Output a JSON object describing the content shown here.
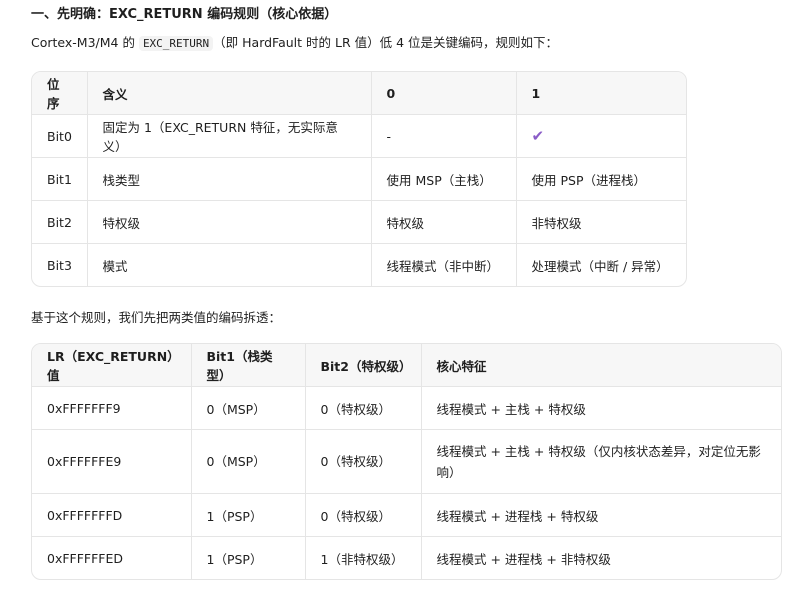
{
  "heading": "一、先明确：EXC_RETURN 编码规则（核心依据）",
  "intro": {
    "before": "Cortex-M3/M4 的 ",
    "code": "EXC_RETURN",
    "after": "（即 HardFault 时的 LR 值）低 4 位是关键编码，规则如下："
  },
  "table1": {
    "headers": [
      "位序",
      "含义",
      "0",
      "1"
    ],
    "rows": [
      [
        "Bit0",
        "固定为 1（EXC_RETURN 特征，无实际意义）",
        "-",
        "✔"
      ],
      [
        "Bit1",
        "栈类型",
        "使用 MSP（主栈）",
        "使用 PSP（进程栈）"
      ],
      [
        "Bit2",
        "特权级",
        "特权级",
        "非特权级"
      ],
      [
        "Bit3",
        "模式",
        "线程模式（非中断）",
        "处理模式（中断 / 异常）"
      ]
    ]
  },
  "para2": "基于这个规则，我们先把两类值的编码拆透：",
  "table2": {
    "headers": [
      "LR（EXC_RETURN）值",
      "Bit1（栈类型）",
      "Bit2（特权级）",
      "核心特征"
    ],
    "rows": [
      [
        "0xFFFFFFF9",
        "0（MSP）",
        "0（特权级）",
        "线程模式 + 主栈 + 特权级"
      ],
      [
        "0xFFFFFFE9",
        "0（MSP）",
        "0（特权级）",
        "线程模式 + 主栈 + 特权级（仅内核状态差异，对定位无影响）"
      ],
      [
        "0xFFFFFFFD",
        "1（PSP）",
        "0（特权级）",
        "线程模式 + 进程栈 + 特权级"
      ],
      [
        "0xFFFFFFED",
        "1（PSP）",
        "1（非特权级）",
        "线程模式 + 进程栈 + 非特权级"
      ]
    ]
  },
  "colors": {
    "check": "#8a5cc7",
    "header_bg": "#f7f7f7",
    "border": "#e5e5e5"
  }
}
